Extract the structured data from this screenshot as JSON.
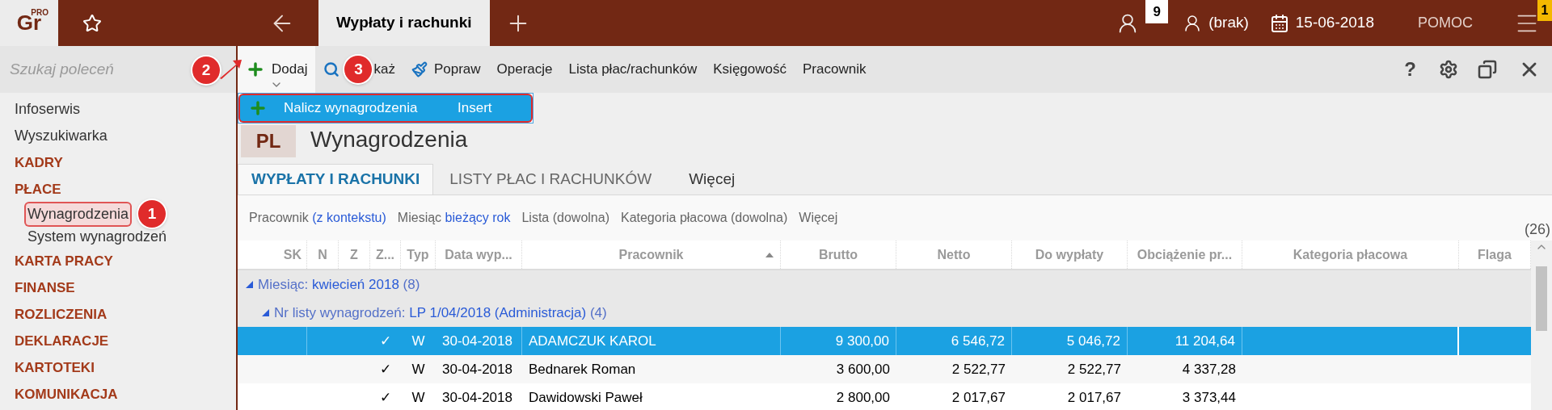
{
  "top_bar": {
    "logo": "Gr",
    "logo_badge": "PRO",
    "tabs": [
      {
        "label": "Wypłaty i rachunki",
        "selected": true
      }
    ],
    "notifications_count": "9",
    "user": "(brak)",
    "date": "15-06-2018",
    "help": "POMOC",
    "menu_badge": "1"
  },
  "sidebar": {
    "search_placeholder": "Szukaj poleceń",
    "items": [
      {
        "label": "Infoserwis",
        "kind": "link",
        "selected": false
      },
      {
        "label": "Wyszukiwarka",
        "kind": "link",
        "selected": false
      },
      {
        "label": "KADRY",
        "kind": "category",
        "selected": false
      },
      {
        "label": "PŁACE",
        "kind": "category",
        "selected": false
      },
      {
        "label": "Wynagrodzenia",
        "kind": "sub",
        "selected": true,
        "callout": "1"
      },
      {
        "label": "System wynagrodzeń",
        "kind": "sub",
        "selected": false
      },
      {
        "label": "KARTA PRACY",
        "kind": "category",
        "selected": false
      },
      {
        "label": "FINANSE",
        "kind": "category",
        "selected": false
      },
      {
        "label": "ROZLICZENIA",
        "kind": "category",
        "selected": false
      },
      {
        "label": "DEKLARACJE",
        "kind": "category",
        "selected": false
      },
      {
        "label": "KARTOTEKI",
        "kind": "category",
        "selected": false
      },
      {
        "label": "KOMUNIKACJA",
        "kind": "category",
        "selected": false
      }
    ]
  },
  "toolbar": {
    "buttons": [
      {
        "label": "Dodaj",
        "kind": "add",
        "expanded": true,
        "callout": "2"
      },
      {
        "label": "każ",
        "kind": "search",
        "callout": "3"
      },
      {
        "label": "Popraw",
        "kind": "edit"
      },
      {
        "label": "Operacje",
        "kind": "text"
      },
      {
        "label": "Lista płac/rachunków",
        "kind": "text"
      },
      {
        "label": "Księgowość",
        "kind": "text"
      },
      {
        "label": "Pracownik",
        "kind": "text"
      }
    ],
    "help_label": "?"
  },
  "dropdown": {
    "items": [
      {
        "label": "Nalicz wynagrodzenia",
        "shortcut": "Insert",
        "selected": true
      }
    ]
  },
  "page": {
    "badge": "PL",
    "title": "Wynagrodzenia"
  },
  "tabs": [
    {
      "label": "WYPŁATY I RACHUNKI",
      "selected": true
    },
    {
      "label": "LISTY PŁAC I RACHUNKÓW",
      "selected": false
    },
    {
      "label": "Więcej",
      "selected": false
    }
  ],
  "filters": [
    {
      "label": "Pracownik",
      "value": "(z kontekstu)",
      "set": true
    },
    {
      "label": "Miesiąc",
      "value": "bieżący rok",
      "set": true
    },
    {
      "label": "Lista",
      "value": "(dowolna)",
      "set": false
    },
    {
      "label": "Kategoria płacowa",
      "value": "(dowolna)",
      "set": false
    },
    {
      "label": "Więcej"
    }
  ],
  "count": "(26)",
  "table": {
    "columns": [
      {
        "label": "SK"
      },
      {
        "label": "N"
      },
      {
        "label": "Z"
      },
      {
        "label": "Z..."
      },
      {
        "label": "Typ"
      },
      {
        "label": "Data wyp..."
      },
      {
        "label": "Pracownik",
        "sorted": true
      },
      {
        "label": "Brutto"
      },
      {
        "label": "Netto"
      },
      {
        "label": "Do wypłaty"
      },
      {
        "label": "Obciążenie pr..."
      },
      {
        "label": "Kategoria płacowa"
      },
      {
        "label": "Flaga"
      }
    ],
    "groups": [
      {
        "label": "Miesiąc:",
        "value": "kwiecień 2018",
        "count": "(8)",
        "expanded": true,
        "children": [
          {
            "label": "Nr listy wynagrodzeń:",
            "value": "LP 1/04/2018 (Administracja)",
            "count": "(4)",
            "expanded": true,
            "children": [
              {
                "selected": true,
                "z": "✓",
                "typ": "W",
                "data": "30-04-2018",
                "pracownik": "ADAMCZUK KAROL",
                "brutto": "9 300,00",
                "netto": "6 546,72",
                "do_wyplaty": "5 046,72",
                "obciazenie": "11 204,64"
              },
              {
                "selected": false,
                "z": "✓",
                "typ": "W",
                "data": "30-04-2018",
                "pracownik": "Bednarek Roman",
                "brutto": "3 600,00",
                "netto": "2 522,77",
                "do_wyplaty": "2 522,77",
                "obciazenie": "4 337,28"
              },
              {
                "selected": false,
                "z": "✓",
                "typ": "W",
                "data": "30-04-2018",
                "pracownik": "Dawidowski Paweł",
                "brutto": "2 800,00",
                "netto": "2 017,67",
                "do_wyplaty": "2 017,67",
                "obciazenie": "3 373,44"
              }
            ]
          }
        ]
      }
    ]
  }
}
